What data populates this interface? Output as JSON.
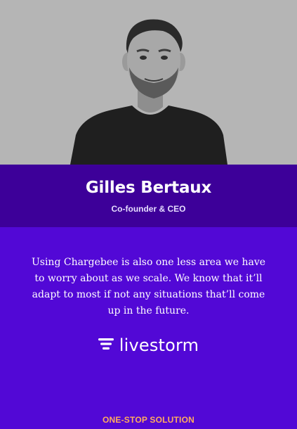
{
  "testimonial": {
    "person_name": "Gilles Bertaux",
    "person_role": "Co-founder & CEO",
    "quote": "Using Chargebee is also one less area we have to worry about as we scale. We know that it’ll adapt to most if not any situations that’ll come up in the future.",
    "company_logo_text": "livestorm",
    "company_logo_icon": "livestorm-logo-icon"
  },
  "section_label": "ONE-STOP SOLUTION",
  "colors": {
    "photo_background": "#b5b5b5",
    "name_band": "#3d0099",
    "quote_background": "#5208d6",
    "accent_label": "#ffab5e",
    "text": "#ffffff"
  }
}
